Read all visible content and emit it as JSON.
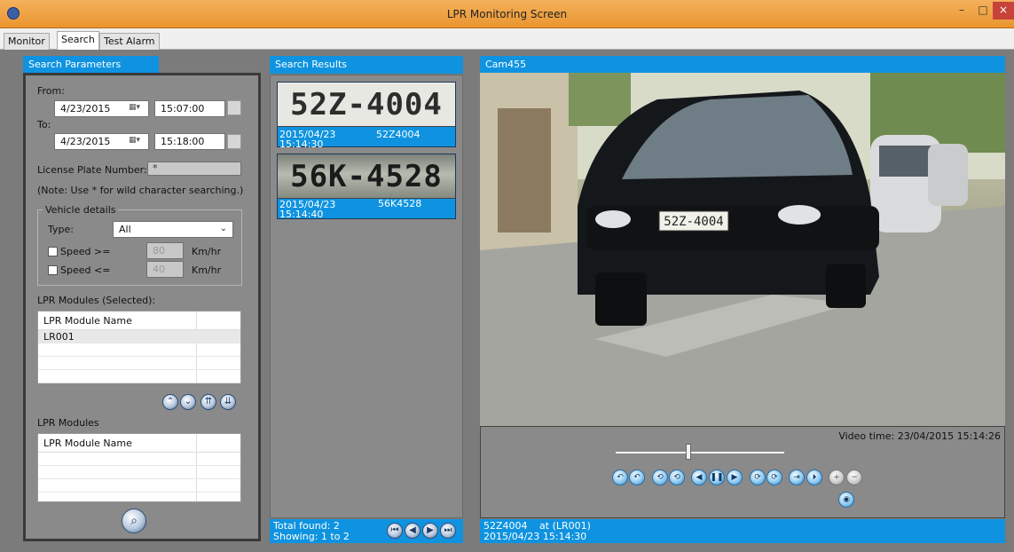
{
  "window": {
    "title": "LPR Monitoring Screen",
    "minimize": "–",
    "maximize": "□",
    "close": "×"
  },
  "tabs": [
    {
      "label": "Monitor"
    },
    {
      "label": "Search"
    },
    {
      "label": "Test Alarm"
    }
  ],
  "search_params": {
    "header": "Search Parameters",
    "from_label": "From:",
    "from_date": "4/23/2015",
    "from_time": "15:07:00",
    "to_label": "To:",
    "to_date": "4/23/2015",
    "to_time": "15:18:00",
    "plate_label": "License Plate Number:",
    "plate_value": "*",
    "note": "(Note: Use * for wild character searching.)",
    "vehicle_details_label": "Vehicle details",
    "type_label": "Type:",
    "type_value": "All",
    "speed_ge_label": "Speed >=",
    "speed_ge_value": "80",
    "speed_le_label": "Speed <=",
    "speed_le_value": "40",
    "unit": "Km/hr",
    "selected_modules_label": "LPR Modules (Selected):",
    "modules_label": "LPR Modules",
    "grid_header": "LPR Module Name",
    "selected_modules": [
      "LR001"
    ]
  },
  "results": {
    "header": "Search Results",
    "items": [
      {
        "plate_image_text": "52Z-4004",
        "date": "2015/04/23",
        "time": "15:14:30",
        "plate": "52Z4004"
      },
      {
        "plate_image_text": "56K-4528",
        "date": "2015/04/23",
        "time": "15:14:40",
        "plate": "56K4528"
      }
    ],
    "total_found": "Total found: 2",
    "showing": "Showing: 1 to 2"
  },
  "camera": {
    "header": "Cam455",
    "plate_in_frame": "52Z-4004",
    "video_time": "Video time: 23/04/2015 15:14:26",
    "playback_progress": 0.43,
    "footer_plate": "52Z4004",
    "footer_module": "at (LR001)",
    "footer_datetime": "2015/04/23 15:14:30"
  },
  "colors": {
    "accent": "#0f93e0",
    "titlebar": "#f0a64a",
    "panel_bg": "#8a8a8a"
  }
}
